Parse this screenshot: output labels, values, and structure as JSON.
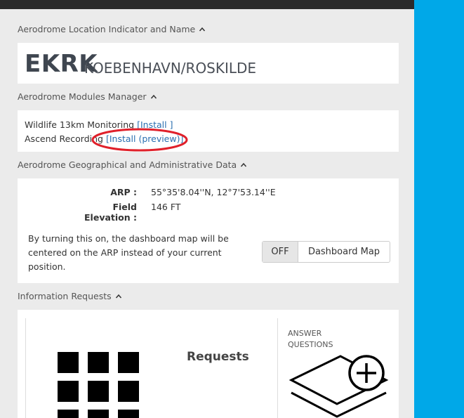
{
  "sections": {
    "location_header": "Aerodrome Location Indicator and Name",
    "modules_header": "Aerodrome Modules Manager",
    "geo_header": "Aerodrome Geographical and Administrative Data",
    "info_header": "Information Requests"
  },
  "station": {
    "icao": "EKRK",
    "name": "KOEBENHAVN/ROSKILDE"
  },
  "modules": {
    "wildlife_label": "Wildlife 13km Monitoring",
    "wildlife_link": "[Install ]",
    "ascend_label": "Ascend Recording",
    "ascend_link": "[Install (preview)]"
  },
  "geo": {
    "arp_label": "ARP :",
    "arp_value": "55°35'8.04''N, 12°7'53.14''E",
    "elev_label": "Field Elevation :",
    "elev_value": "146 FT",
    "note": "By turning this on, the dashboard map will be centered on the ARP instead of your current position.",
    "toggle_state": "OFF",
    "toggle_label": "Dashboard Map"
  },
  "info": {
    "requests_title": "Requests",
    "answer_label": "ANSWER QUESTIONS"
  },
  "colors": {
    "background": "#00a8e8",
    "panel": "#ebebeb",
    "annotation": "#e0202a",
    "link": "#2a6fb0"
  }
}
